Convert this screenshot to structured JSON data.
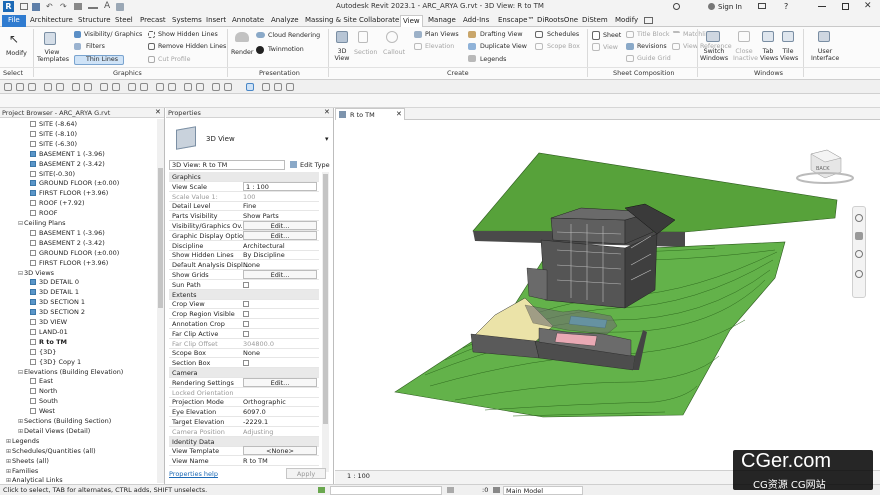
{
  "window": {
    "title": "Autodesk Revit 2023.1 - ARC_ARYA G.rvt - 3D View: R to TM",
    "sign_in": "Sign In"
  },
  "tabs": [
    "File",
    "Architecture",
    "Structure",
    "Steel",
    "Precast",
    "Systems",
    "Insert",
    "Annotate",
    "Analyze",
    "Massing & Site",
    "Collaborate",
    "View",
    "Manage",
    "Add-Ins",
    "Enscape™",
    "DiRootsOne",
    "DiStem",
    "Modify"
  ],
  "ribbon": {
    "modify": "Modify",
    "view_templates": "View Templates",
    "visibility": "Visibility/ Graphics",
    "filters": "Filters",
    "thin_lines": "Thin Lines",
    "show_hidden": "Show Hidden Lines",
    "remove_hidden": "Remove Hidden Lines",
    "cut_profile": "Cut Profile",
    "render": "Render",
    "cloud_rendering": "Cloud Rendering",
    "twinmotion": "Twinmotion",
    "view3d": "3D View",
    "section": "Section",
    "callout": "Callout",
    "plan_views": "Plan Views",
    "elevation": "Elevation",
    "drafting_view": "Drafting View",
    "duplicate_view": "Duplicate View",
    "legends": "Legends",
    "schedules": "Schedules",
    "scope_box": "Scope Box",
    "sheet": "Sheet",
    "view": "View",
    "title_block": "Title Block",
    "revisions": "Revisions",
    "guide_grid": "Guide Grid",
    "matchline": "Matchline",
    "view_reference": "View Reference",
    "switch_windows": "Switch Windows",
    "close_inactive": "Close Inactive",
    "tab_views": "Tab Views",
    "tile_views": "Tile Views",
    "user_interface": "User Interface",
    "groups": {
      "select": "Select",
      "graphics": "Graphics",
      "presentation": "Presentation",
      "create": "Create",
      "sheet_composition": "Sheet Composition",
      "windows": "Windows"
    }
  },
  "browser": {
    "header": "Project Browser - ARC_ARYA G.rvt",
    "items": [
      {
        "label": "SITE (-8.64)",
        "indent": 3,
        "chk": "empty"
      },
      {
        "label": "SITE (-8.10)",
        "indent": 3,
        "chk": "empty"
      },
      {
        "label": "SITE (-6.30)",
        "indent": 3,
        "chk": "empty"
      },
      {
        "label": "BASEMENT 1 (-3.96)",
        "indent": 3,
        "chk": "filled"
      },
      {
        "label": "BASEMENT 2 (-3.42)",
        "indent": 3,
        "chk": "filled"
      },
      {
        "label": "SITE(-0.30)",
        "indent": 3,
        "chk": "empty"
      },
      {
        "label": "GROUND FLOOR (±0.00)",
        "indent": 3,
        "chk": "filled"
      },
      {
        "label": "FIRST FLOOR (+3.96)",
        "indent": 3,
        "chk": "filled"
      },
      {
        "label": "ROOF (+7.92)",
        "indent": 3,
        "chk": "empty"
      },
      {
        "label": "ROOF",
        "indent": 3,
        "chk": "empty"
      },
      {
        "label": "Ceiling Plans",
        "indent": 2,
        "chk": "none",
        "tw": "⊟"
      },
      {
        "label": "BASEMENT 1 (-3.96)",
        "indent": 3,
        "chk": "empty"
      },
      {
        "label": "BASEMENT 2 (-3.42)",
        "indent": 3,
        "chk": "empty"
      },
      {
        "label": "GROUND FLOOR (±0.00)",
        "indent": 3,
        "chk": "empty"
      },
      {
        "label": "FIRST FLOOR (+3.96)",
        "indent": 3,
        "chk": "empty"
      },
      {
        "label": "3D Views",
        "indent": 2,
        "chk": "none",
        "tw": "⊟"
      },
      {
        "label": "3D DETAIL 0",
        "indent": 3,
        "chk": "filled"
      },
      {
        "label": "3D DETAIL 1",
        "indent": 3,
        "chk": "filled"
      },
      {
        "label": "3D SECTION 1",
        "indent": 3,
        "chk": "filled"
      },
      {
        "label": "3D SECTION 2",
        "indent": 3,
        "chk": "filled"
      },
      {
        "label": "3D VIEW",
        "indent": 3,
        "chk": "empty"
      },
      {
        "label": "LAND-01",
        "indent": 3,
        "chk": "empty"
      },
      {
        "label": "R to TM",
        "indent": 3,
        "chk": "empty",
        "bold": true
      },
      {
        "label": "{3D}",
        "indent": 3,
        "chk": "empty"
      },
      {
        "label": "{3D} Copy 1",
        "indent": 3,
        "chk": "empty"
      },
      {
        "label": "Elevations (Building Elevation)",
        "indent": 2,
        "chk": "none",
        "tw": "⊟"
      },
      {
        "label": "East",
        "indent": 3,
        "chk": "empty"
      },
      {
        "label": "North",
        "indent": 3,
        "chk": "empty"
      },
      {
        "label": "South",
        "indent": 3,
        "chk": "empty"
      },
      {
        "label": "West",
        "indent": 3,
        "chk": "empty"
      },
      {
        "label": "Sections (Building Section)",
        "indent": 2,
        "chk": "none",
        "tw": "⊞"
      },
      {
        "label": "Detail Views (Detail)",
        "indent": 2,
        "chk": "none",
        "tw": "⊞"
      },
      {
        "label": "Legends",
        "indent": 1,
        "chk": "none",
        "tw": "⊞"
      },
      {
        "label": "Schedules/Quantities (all)",
        "indent": 1,
        "chk": "none",
        "tw": "⊞"
      },
      {
        "label": "Sheets (all)",
        "indent": 1,
        "chk": "none",
        "tw": "⊞"
      },
      {
        "label": "Families",
        "indent": 1,
        "chk": "none",
        "tw": "⊞"
      },
      {
        "label": "Analytical Links",
        "indent": 1,
        "chk": "none",
        "tw": "⊞"
      }
    ]
  },
  "props": {
    "header": "Properties",
    "type": "3D View",
    "selector": "3D View: R to TM",
    "edit_type": "Edit Type",
    "rows": [
      {
        "k": "Graphics",
        "sec": true
      },
      {
        "k": "View Scale",
        "v": "1 : 100",
        "box": true
      },
      {
        "k": "Scale Value    1:",
        "v": "100",
        "dis": true
      },
      {
        "k": "Detail Level",
        "v": "Fine"
      },
      {
        "k": "Parts Visibility",
        "v": "Show Parts"
      },
      {
        "k": "Visibility/Graphics Ov...",
        "v": "Edit...",
        "btn": true
      },
      {
        "k": "Graphic Display Optio...",
        "v": "Edit...",
        "btn": true
      },
      {
        "k": "Discipline",
        "v": "Architectural"
      },
      {
        "k": "Show Hidden Lines",
        "v": "By Discipline"
      },
      {
        "k": "Default Analysis Displ...",
        "v": "None"
      },
      {
        "k": "Show Grids",
        "v": "Edit...",
        "btn": true
      },
      {
        "k": "Sun Path",
        "cb": true
      },
      {
        "k": "Extents",
        "sec": true
      },
      {
        "k": "Crop View",
        "cb": true
      },
      {
        "k": "Crop Region Visible",
        "cb": true
      },
      {
        "k": "Annotation Crop",
        "cb": true
      },
      {
        "k": "Far Clip Active",
        "cb": true
      },
      {
        "k": "Far Clip Offset",
        "v": "304800.0",
        "dis": true
      },
      {
        "k": "Scope Box",
        "v": "None"
      },
      {
        "k": "Section Box",
        "cb": true
      },
      {
        "k": "Camera",
        "sec": true
      },
      {
        "k": "Rendering Settings",
        "v": "Edit...",
        "btn": true
      },
      {
        "k": "Locked Orientation",
        "dis": true
      },
      {
        "k": "Projection Mode",
        "v": "Orthographic"
      },
      {
        "k": "Eye Elevation",
        "v": "6097.0"
      },
      {
        "k": "Target Elevation",
        "v": "-2229.1"
      },
      {
        "k": "Camera Position",
        "v": "Adjusting",
        "dis": true
      },
      {
        "k": "Identity Data",
        "sec": true
      },
      {
        "k": "View Template",
        "v": "<None>",
        "btn": true
      },
      {
        "k": "View Name",
        "v": "R to TM"
      }
    ],
    "help": "Properties help",
    "apply": "Apply"
  },
  "view": {
    "tab": "R to TM",
    "scale": "1 : 100",
    "cube_label": "BACK"
  },
  "status": {
    "hint": "Click to select, TAB for alternates, CTRL adds, SHIFT unselects.",
    "model": "Main Model",
    "zero": ":0"
  },
  "watermark": {
    "main": "CGer.com",
    "sub": "CG资源 CG网站"
  },
  "colors": {
    "grass": "#57a23a",
    "grass_light": "#63b24a",
    "sand": "#ebe3a8",
    "pool": "#5ac8ee",
    "wall": "#555555"
  }
}
